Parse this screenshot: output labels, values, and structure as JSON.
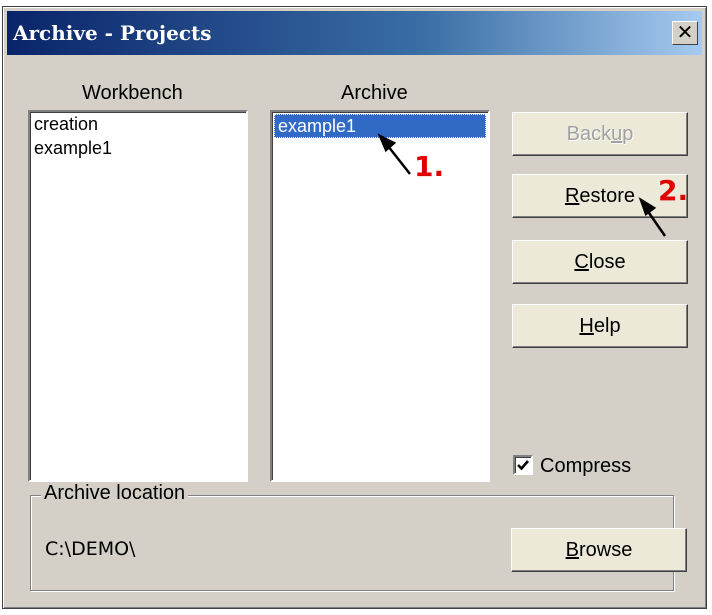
{
  "window": {
    "title": "Archive - Projects",
    "close_glyph": "✕"
  },
  "workbench": {
    "label": "Workbench",
    "items": [
      "creation",
      "example1"
    ]
  },
  "archive": {
    "label": "Archive",
    "items": [
      "example1"
    ],
    "selected_index": 0
  },
  "buttons": {
    "backup": {
      "pre": "Back",
      "u": "u",
      "post": "p",
      "enabled": false
    },
    "restore": {
      "pre": "",
      "u": "R",
      "post": "estore",
      "enabled": true
    },
    "close": {
      "pre": "",
      "u": "C",
      "post": "lose",
      "enabled": true
    },
    "help": {
      "pre": "",
      "u": "H",
      "post": "elp",
      "enabled": true
    }
  },
  "compress": {
    "label": "Compress",
    "checked": true
  },
  "location": {
    "label": "Archive location",
    "path": "C:\\DEMO\\"
  },
  "browse": {
    "pre": "",
    "u": "B",
    "post": "rowse"
  },
  "annotations": {
    "step1": "1.",
    "step2": "2."
  },
  "colors": {
    "selection": "#316ac5",
    "annotation": "#e00000",
    "title_start": "#0a246a"
  }
}
